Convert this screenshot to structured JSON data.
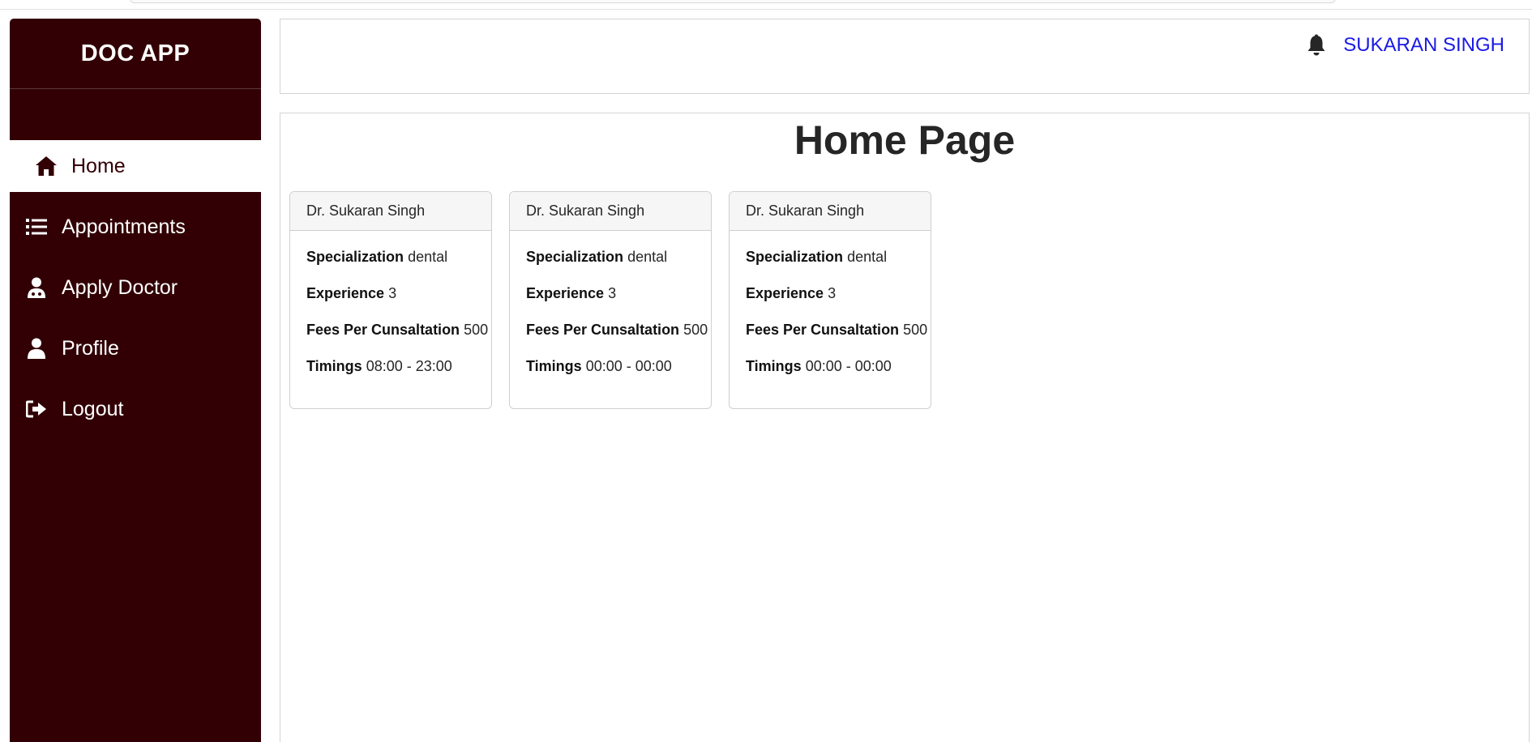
{
  "sidebar": {
    "brand": "DOC APP",
    "items": [
      {
        "label": "Home",
        "icon": "home-icon",
        "active": true
      },
      {
        "label": "Appointments",
        "icon": "list-icon",
        "active": false
      },
      {
        "label": "Apply Doctor",
        "icon": "doctor-icon",
        "active": false
      },
      {
        "label": "Profile",
        "icon": "user-icon",
        "active": false
      },
      {
        "label": "Logout",
        "icon": "logout-icon",
        "active": false
      }
    ]
  },
  "header": {
    "notification_icon": "bell-icon",
    "user_name": "SUKARAN SINGH"
  },
  "main": {
    "title": "Home Page",
    "doctors": [
      {
        "name": "Dr. Sukaran Singh",
        "specialization_label": "Specialization",
        "specialization": "dental",
        "experience_label": "Experience",
        "experience": "3",
        "fees_label": "Fees Per Cunsaltation",
        "fees": "500",
        "timings_label": "Timings",
        "timings": "08:00 - 23:00"
      },
      {
        "name": "Dr. Sukaran Singh",
        "specialization_label": "Specialization",
        "specialization": "dental",
        "experience_label": "Experience",
        "experience": "3",
        "fees_label": "Fees Per Cunsaltation",
        "fees": "500",
        "timings_label": "Timings",
        "timings": "00:00 - 00:00"
      },
      {
        "name": "Dr. Sukaran Singh",
        "specialization_label": "Specialization",
        "specialization": "dental",
        "experience_label": "Experience",
        "experience": "3",
        "fees_label": "Fees Per Cunsaltation",
        "fees": "500",
        "timings_label": "Timings",
        "timings": "00:00 - 00:00"
      }
    ]
  },
  "colors": {
    "sidebar_bg": "#320004",
    "user_link": "#1a1ae6",
    "title_text": "#262626"
  }
}
